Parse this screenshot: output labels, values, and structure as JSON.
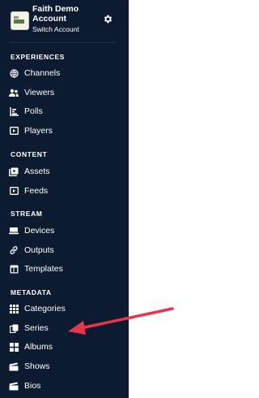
{
  "account": {
    "name": "Faith Demo Account",
    "switch_label": "Switch Account"
  },
  "sections": [
    {
      "title": "EXPERIENCES",
      "items": [
        {
          "label": "Channels",
          "icon": "globe-icon"
        },
        {
          "label": "Viewers",
          "icon": "users-icon"
        },
        {
          "label": "Polls",
          "icon": "poll-icon"
        },
        {
          "label": "Players",
          "icon": "player-icon"
        }
      ]
    },
    {
      "title": "CONTENT",
      "items": [
        {
          "label": "Assets",
          "icon": "assets-icon"
        },
        {
          "label": "Feeds",
          "icon": "feed-icon"
        }
      ]
    },
    {
      "title": "STREAM",
      "items": [
        {
          "label": "Devices",
          "icon": "device-icon"
        },
        {
          "label": "Outputs",
          "icon": "link-icon"
        },
        {
          "label": "Templates",
          "icon": "template-icon"
        }
      ]
    },
    {
      "title": "METADATA",
      "items": [
        {
          "label": "Categories",
          "icon": "categories-icon"
        },
        {
          "label": "Series",
          "icon": "series-icon"
        },
        {
          "label": "Albums",
          "icon": "albums-icon"
        },
        {
          "label": "Shows",
          "icon": "shows-icon"
        },
        {
          "label": "Bios",
          "icon": "bios-icon"
        }
      ]
    }
  ],
  "annotation": {
    "color": "#e8354a",
    "target": "Series"
  }
}
